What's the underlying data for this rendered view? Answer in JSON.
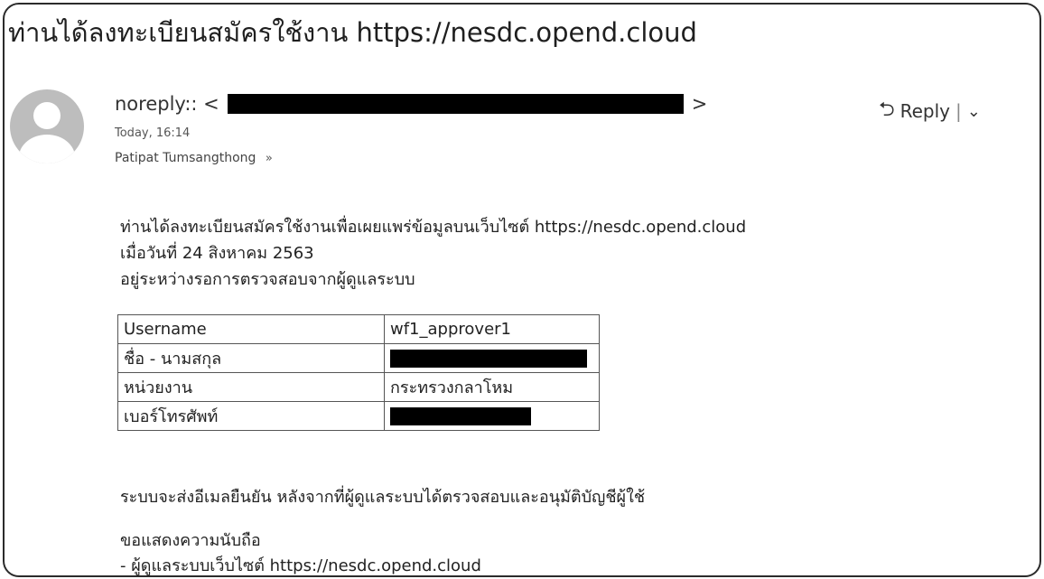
{
  "email": {
    "subject": "ท่านได้ลงทะเบียนสมัครใช้งาน https://nesdc.opend.cloud",
    "from_label": "noreply:: <",
    "from_close": ">",
    "date": "Today, 16:14",
    "to": "Patipat Tumsangthong",
    "to_expand_icon": "double-chevron-down-icon",
    "reply_label": "Reply",
    "reply_separator": "|",
    "reply_icon": "reply-arrow-icon",
    "reply_more_icon": "chevron-down-icon"
  },
  "body": {
    "line1": "ท่านได้ลงทะเบียนสมัครใช้งานเพื่อเผยแพร่ข้อมูลบนเว็บไซต์ https://nesdc.opend.cloud",
    "line2": "เมื่อวันที่ 24 สิงหาคม 2563",
    "line3": "อยู่ระหว่างรอการตรวจสอบจากผู้ดูแลระบบ",
    "confirm": "ระบบจะส่งอีเมลยืนยัน หลังจากที่ผู้ดูแลระบบได้ตรวจสอบและอนุมัติบัญชีผู้ใช้",
    "regards": "ขอแสดงความนับถือ",
    "signature": " - ผู้ดูแลระบบเว็บไซต์ https://nesdc.opend.cloud"
  },
  "table": {
    "rows": [
      {
        "key": "Username",
        "value": "wf1_approver1"
      },
      {
        "key": "ชื่อ - นามสกุล",
        "value": ""
      },
      {
        "key": "หน่วยงาน",
        "value": "กระทรวงกลาโหม"
      },
      {
        "key": "เบอร์โทรศัพท์",
        "value": ""
      }
    ]
  },
  "colors": {
    "border": "#2b2b2b",
    "avatar": "#bdbdbd",
    "redaction": "#000000"
  }
}
